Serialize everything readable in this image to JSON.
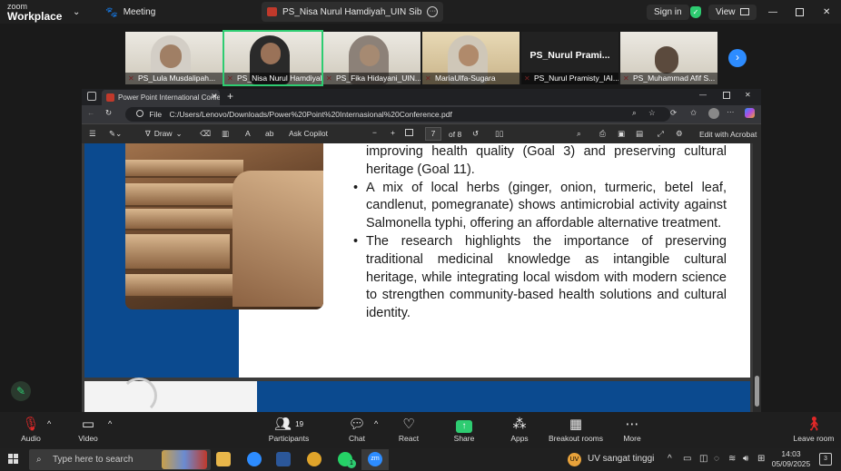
{
  "zoom": {
    "logo_line1": "zoom",
    "logo_line2": "Workplace",
    "meeting_label": "Meeting",
    "share_title": "PS_Nisa Nurul Hamdiyah_UIN Sib",
    "sign_in": "Sign in",
    "view": "View"
  },
  "gallery": {
    "tiles": [
      {
        "label": "PS_Lula Musdalipah..."
      },
      {
        "label": "PS_Nisa Nurul Hamdiyah..."
      },
      {
        "label": "PS_Fika Hidayani_UIN..."
      },
      {
        "label": "MariaUlfa-Sugara"
      },
      {
        "label": "PS_Nurul Pramisty_IAI...",
        "big": "PS_Nurul Prami..."
      },
      {
        "label": "PS_Muhammad Afif S..."
      }
    ]
  },
  "browser": {
    "tab_title": "Power Point International Confere...",
    "url_prefix": "File",
    "url": "C:/Users/Lenovo/Downloads/Power%20Point%20Internasional%20Conference.pdf",
    "pdf_toolbar": {
      "draw": "Draw",
      "ask_copilot": "Ask Copilot",
      "page_current": "7",
      "page_total": "of 8",
      "edit_acrobat": "Edit with Acrobat"
    }
  },
  "slide": {
    "intro": "improving health quality (Goal 3) and preserving cultural heritage (Goal 11).",
    "bullets": [
      "A mix of local herbs (ginger, onion, turmeric, betel leaf, candlenut, pomegranate) shows antimicrobial activity against Salmonella typhi, offering an affordable alternative treatment.",
      "The research highlights the importance of preserving traditional medicinal knowledge as intangible cultural heritage, while integrating local wisdom with modern science to strengthen community-based health solutions and cultural identity."
    ]
  },
  "controls": {
    "audio": "Audio",
    "video": "Video",
    "participants": "Participants",
    "participants_count": "19",
    "chat": "Chat",
    "react": "React",
    "share": "Share",
    "apps": "Apps",
    "breakout": "Breakout rooms",
    "more": "More",
    "leave": "Leave room"
  },
  "taskbar": {
    "search_placeholder": "Type here to search",
    "uv_badge": "UV",
    "weather": "UV sangat tinggi",
    "time": "14:03",
    "date": "05/09/2025",
    "notif_count": "3",
    "chat_badge": "1"
  },
  "colors": {
    "zoom_blue": "#2d8cff",
    "share_green": "#2ecc71",
    "slide_blue": "#0b4a8f",
    "leave_red": "#e02828"
  }
}
